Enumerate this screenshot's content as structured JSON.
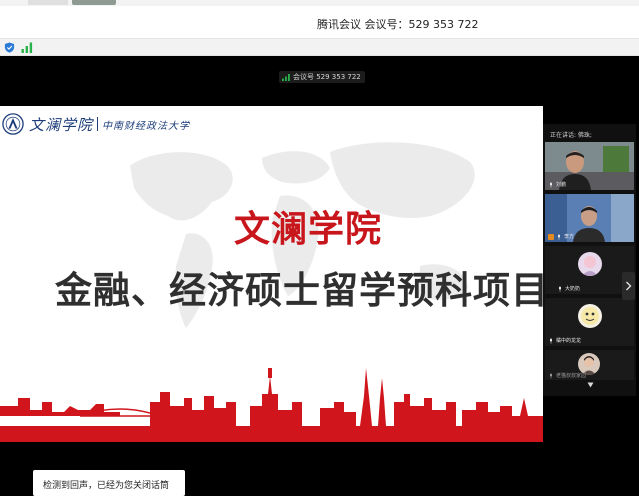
{
  "window": {
    "title": "腾讯会议 会议号：529 353 722"
  },
  "meeting_indicator": {
    "text": "会议号 529 353 722"
  },
  "slide": {
    "logo_cn": "文澜学院",
    "logo_univ": "中南财经政法大学",
    "title_line1": "文澜学院",
    "title_line2": "金融、经济硕士留学预科项目"
  },
  "participants_panel": {
    "speaking_label": "正在讲话: 佛珠;",
    "tiles": [
      {
        "name": "刘鹏",
        "kind": "video"
      },
      {
        "name": "李方",
        "kind": "video"
      },
      {
        "name": "大奶奶",
        "kind": "avatar"
      },
      {
        "name": "橘中的龙龙",
        "kind": "avatar"
      },
      {
        "name": "老猫叔叔家园",
        "kind": "avatar"
      }
    ]
  },
  "toast": {
    "text": "检测到回声，已经为您关闭话筒"
  },
  "colors": {
    "slide_accent": "#c8161d",
    "logo_blue": "#1c3d7a",
    "video_bg": "#000000",
    "status_green": "#2ab24a"
  },
  "icons": [
    "shield-icon",
    "signal-strength-icon",
    "microphone-icon",
    "chevron-right-icon",
    "chevron-down-icon"
  ]
}
